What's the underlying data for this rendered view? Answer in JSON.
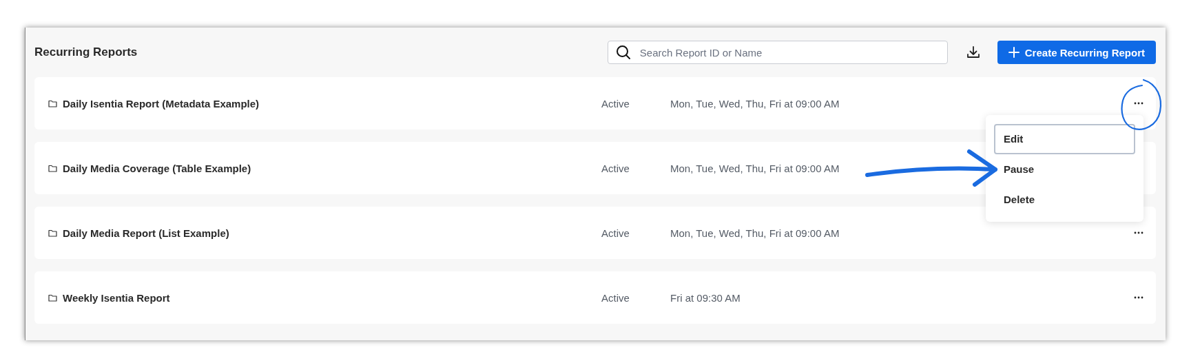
{
  "title": "Recurring Reports",
  "search": {
    "placeholder": "Search Report ID or Name"
  },
  "create_button": "Create Recurring Report",
  "reports": [
    {
      "name": "Daily Isentia Report (Metadata Example)",
      "status": "Active",
      "schedule": "Mon, Tue, Wed, Thu, Fri at 09:00 AM",
      "menu_open": true
    },
    {
      "name": "Daily Media Coverage (Table Example)",
      "status": "Active",
      "schedule": "Mon, Tue, Wed, Thu, Fri at 09:00 AM",
      "menu_open": false
    },
    {
      "name": "Daily Media Report (List Example)",
      "status": "Active",
      "schedule": "Mon, Tue, Wed, Thu, Fri at 09:00 AM",
      "menu_open": false
    },
    {
      "name": "Weekly Isentia Report",
      "status": "Active",
      "schedule": "Fri at 09:30 AM",
      "menu_open": false
    }
  ],
  "row_menu": [
    {
      "label": "Edit",
      "selected": true
    },
    {
      "label": "Pause",
      "selected": false
    },
    {
      "label": "Delete",
      "selected": false
    }
  ]
}
